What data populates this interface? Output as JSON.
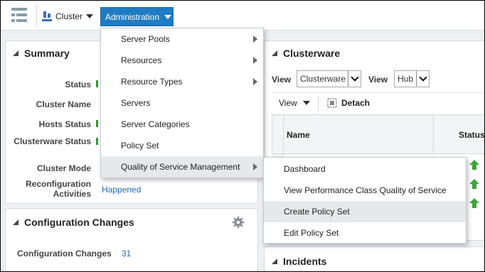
{
  "toolbar": {
    "cluster_label": "Cluster",
    "admin_label": "Administration"
  },
  "summary": {
    "title": "Summary",
    "rows": [
      {
        "label": "Status"
      },
      {
        "label": "Cluster Name"
      },
      {
        "label": "Hosts Status"
      },
      {
        "label": "Clusterware Status"
      },
      {
        "label": "Cluster Mode"
      },
      {
        "label": "Reconfiguration Activities",
        "value": "Happened"
      }
    ]
  },
  "config": {
    "title": "Configuration Changes",
    "row_label": "Configuration Changes",
    "row_value": "31"
  },
  "clusterware": {
    "title": "Clusterware",
    "view1_label": "View",
    "view1_value": "Clusterware",
    "view2_label": "View",
    "view2_value": "Hub",
    "table_view_label": "View",
    "detach_label": "Detach",
    "col_name": "Name",
    "col_status": "Status"
  },
  "incidents": {
    "title": "Incidents"
  },
  "admin_menu": {
    "items": [
      {
        "label": "Server Pools",
        "submenu": true
      },
      {
        "label": "Resources",
        "submenu": true
      },
      {
        "label": "Resource Types",
        "submenu": true
      },
      {
        "label": "Servers",
        "submenu": false
      },
      {
        "label": "Server Categories",
        "submenu": false
      },
      {
        "label": "Policy Set",
        "submenu": false
      },
      {
        "label": "Quality of Service Management",
        "submenu": true
      }
    ]
  },
  "qos_menu": {
    "items": [
      {
        "label": "Dashboard"
      },
      {
        "label": "View Performance Class Quality of Service"
      },
      {
        "label": "Create Policy Set"
      },
      {
        "label": "Edit Policy Set"
      }
    ]
  },
  "colors": {
    "accent": "#1f7bc2",
    "link": "#1f6ab0",
    "status_green": "#2f9a2f"
  },
  "icons": [
    "navigator-icon",
    "cluster-icon",
    "gear-icon",
    "detach-icon",
    "status-up-arrow-icon"
  ]
}
